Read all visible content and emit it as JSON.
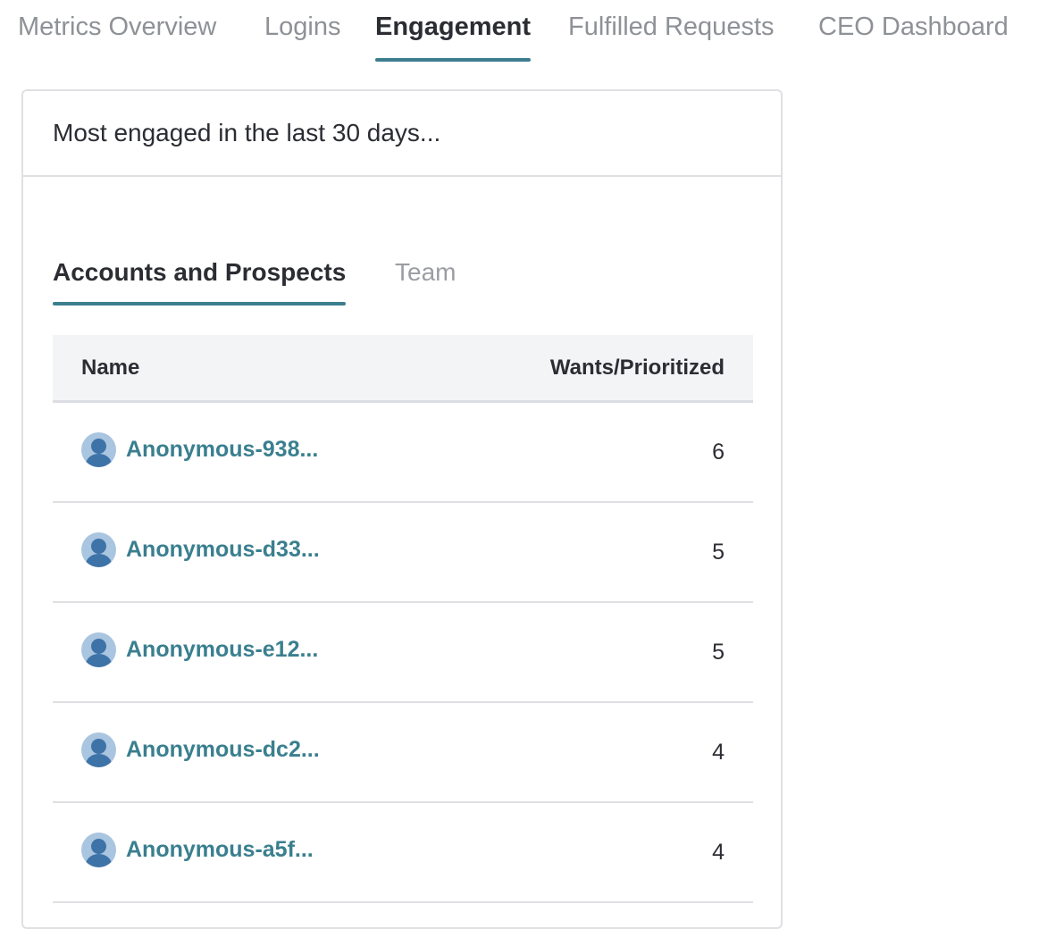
{
  "top_tabs": [
    {
      "label": "Metrics Overview",
      "active": false
    },
    {
      "label": "Logins",
      "active": false
    },
    {
      "label": "Engagement",
      "active": true
    },
    {
      "label": "Fulfilled Requests",
      "active": false
    },
    {
      "label": "CEO Dashboard",
      "active": false
    }
  ],
  "card": {
    "title": "Most engaged in the last 30 days..."
  },
  "sub_tabs": [
    {
      "label": "Accounts and Prospects",
      "active": true
    },
    {
      "label": "Team",
      "active": false
    }
  ],
  "table": {
    "columns": [
      "Name",
      "Wants/Prioritized"
    ],
    "rows": [
      {
        "name": "Anonymous-938...",
        "count": "6"
      },
      {
        "name": "Anonymous-d33...",
        "count": "5"
      },
      {
        "name": "Anonymous-e12...",
        "count": "5"
      },
      {
        "name": "Anonymous-dc2...",
        "count": "4"
      },
      {
        "name": "Anonymous-a5f...",
        "count": "4"
      }
    ]
  },
  "colors": {
    "accent": "#3b7e8e",
    "link": "#3a7f8f",
    "avatar_bg": "#a9c5e0",
    "avatar_fg": "#3e73a8"
  },
  "icons": {
    "avatar": "user-avatar-icon"
  }
}
